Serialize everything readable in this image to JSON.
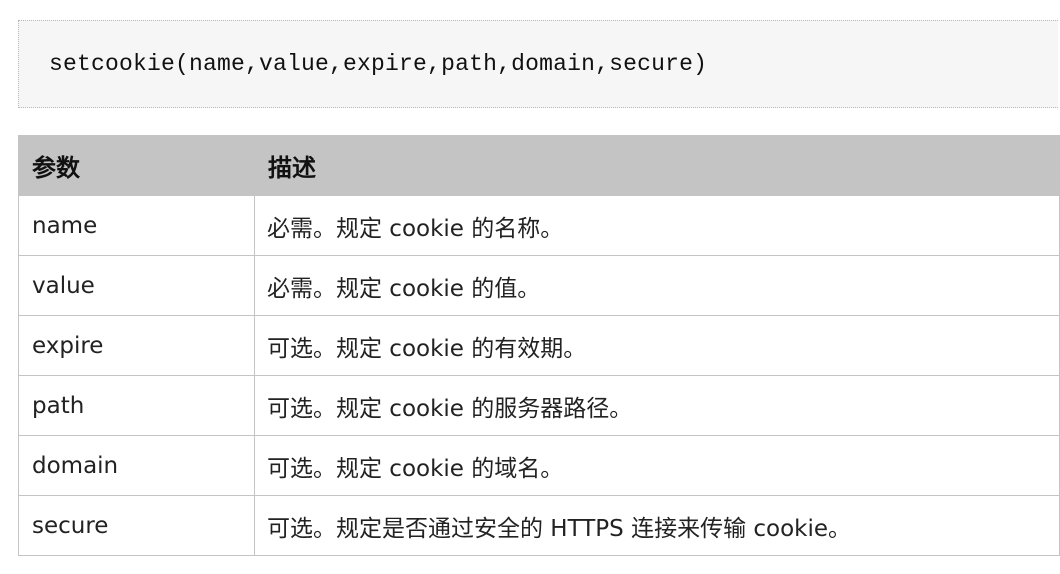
{
  "code": {
    "signature": "setcookie(name,value,expire,path,domain,secure)"
  },
  "table": {
    "headers": {
      "param": "参数",
      "desc": "描述"
    },
    "rows": [
      {
        "param": "name",
        "desc": "必需。规定 cookie 的名称。"
      },
      {
        "param": "value",
        "desc": "必需。规定 cookie 的值。"
      },
      {
        "param": "expire",
        "desc": "可选。规定 cookie 的有效期。"
      },
      {
        "param": "path",
        "desc": "可选。规定 cookie 的服务器路径。"
      },
      {
        "param": "domain",
        "desc": "可选。规定 cookie 的域名。"
      },
      {
        "param": "secure",
        "desc": "可选。规定是否通过安全的 HTTPS 连接来传输 cookie。"
      }
    ]
  },
  "colors": {
    "header_bg": "#c4c4c4",
    "code_bg": "#f6f6f6",
    "border": "#c4c4c4"
  }
}
